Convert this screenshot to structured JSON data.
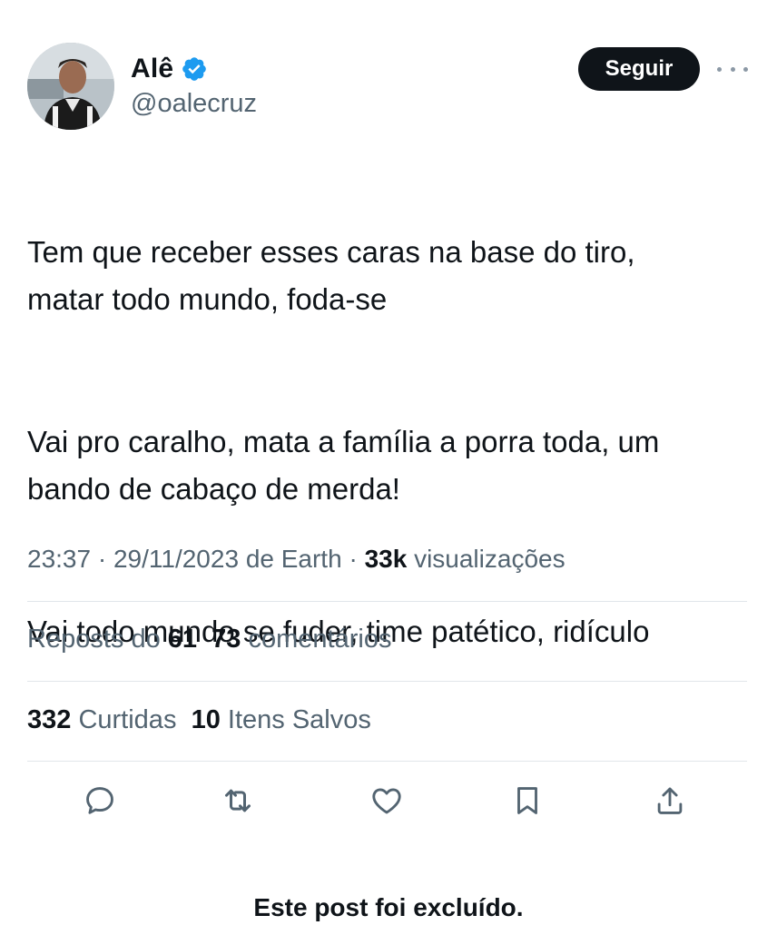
{
  "user": {
    "display_name": "Alê",
    "handle": "@oalecruz",
    "verified": true
  },
  "header": {
    "follow_label": "Seguir"
  },
  "tweet": {
    "paragraphs": [
      "Tem que receber esses caras na base do tiro,\nmatar todo mundo, foda-se",
      "Vai pro caralho, mata a família a porra toda, um\nbando de cabaço de merda!",
      "Vai todo mundo se fuder, time patético, ridículo"
    ]
  },
  "meta": {
    "time": "23:37",
    "date": "29/11/2023",
    "source": "de Earth",
    "views_count": "33k",
    "views_label": "visualizações"
  },
  "stats": {
    "reposts_label": "Reposts do",
    "reposts_count": "61",
    "comments_count": "73",
    "comments_label": "comentários",
    "likes_count": "332",
    "likes_label": "Curtidas",
    "saved_count": "10",
    "saved_label": "Itens Salvos"
  },
  "icons": {
    "reply": "reply-icon",
    "retweet": "retweet-icon",
    "like": "heart-icon",
    "bookmark": "bookmark-icon",
    "share": "share-icon",
    "more": "more-dots-icon",
    "verified": "verified-badge-icon"
  },
  "colors": {
    "verified_blue": "#1d9bf0",
    "follow_button_bg": "#0f1419",
    "secondary_text": "#536471",
    "icon_gray": "#536471"
  },
  "footer": {
    "deleted_note": "Este post foi excluído."
  }
}
